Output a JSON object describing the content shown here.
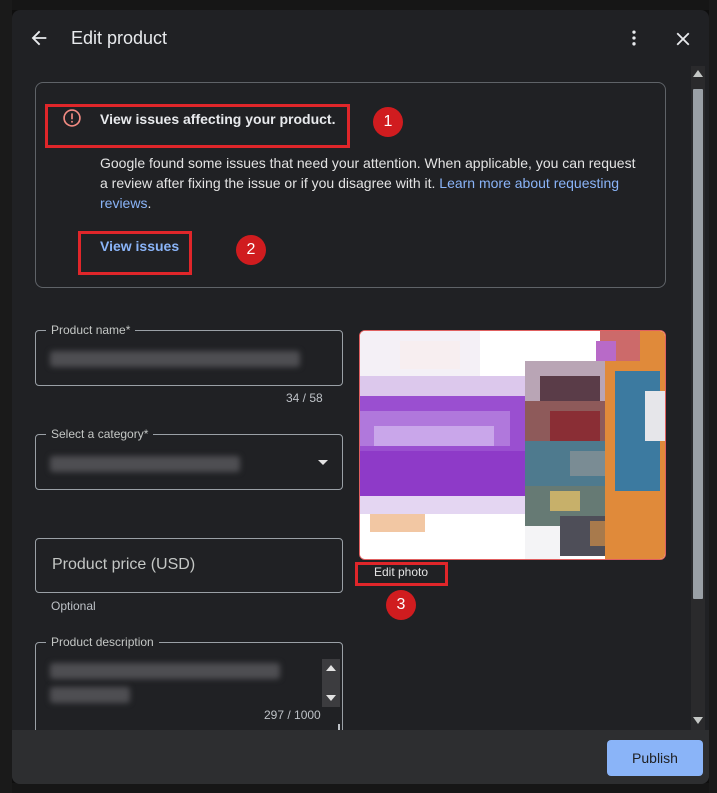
{
  "header": {
    "title": "Edit product"
  },
  "issues": {
    "title": "View issues affecting your product.",
    "body": "Google found some issues that need your attention. When applicable, you can request a review after fixing the issue or if you disagree with it.",
    "link": "Learn more about requesting reviews",
    "body_end": ".",
    "action": "View issues"
  },
  "annotations": [
    "1",
    "2",
    "3"
  ],
  "form": {
    "product_name": {
      "label": "Product name*",
      "counter": "34 / 58"
    },
    "category": {
      "label": "Select a category*"
    },
    "price": {
      "placeholder": "Product price (USD)",
      "helper": "Optional"
    },
    "description": {
      "label": "Product description",
      "counter": "297 / 1000"
    }
  },
  "photo": {
    "action": "Edit photo"
  },
  "footer": {
    "publish_label": "Publish"
  },
  "colors": {
    "accent": "#8ab4f8",
    "annotation_red": "#d01c1f",
    "surface": "#202124",
    "footer": "#2d2e30"
  },
  "icons": [
    "back-arrow-icon",
    "more-vert-icon",
    "close-icon",
    "warning-icon",
    "dropdown-arrow-icon"
  ]
}
